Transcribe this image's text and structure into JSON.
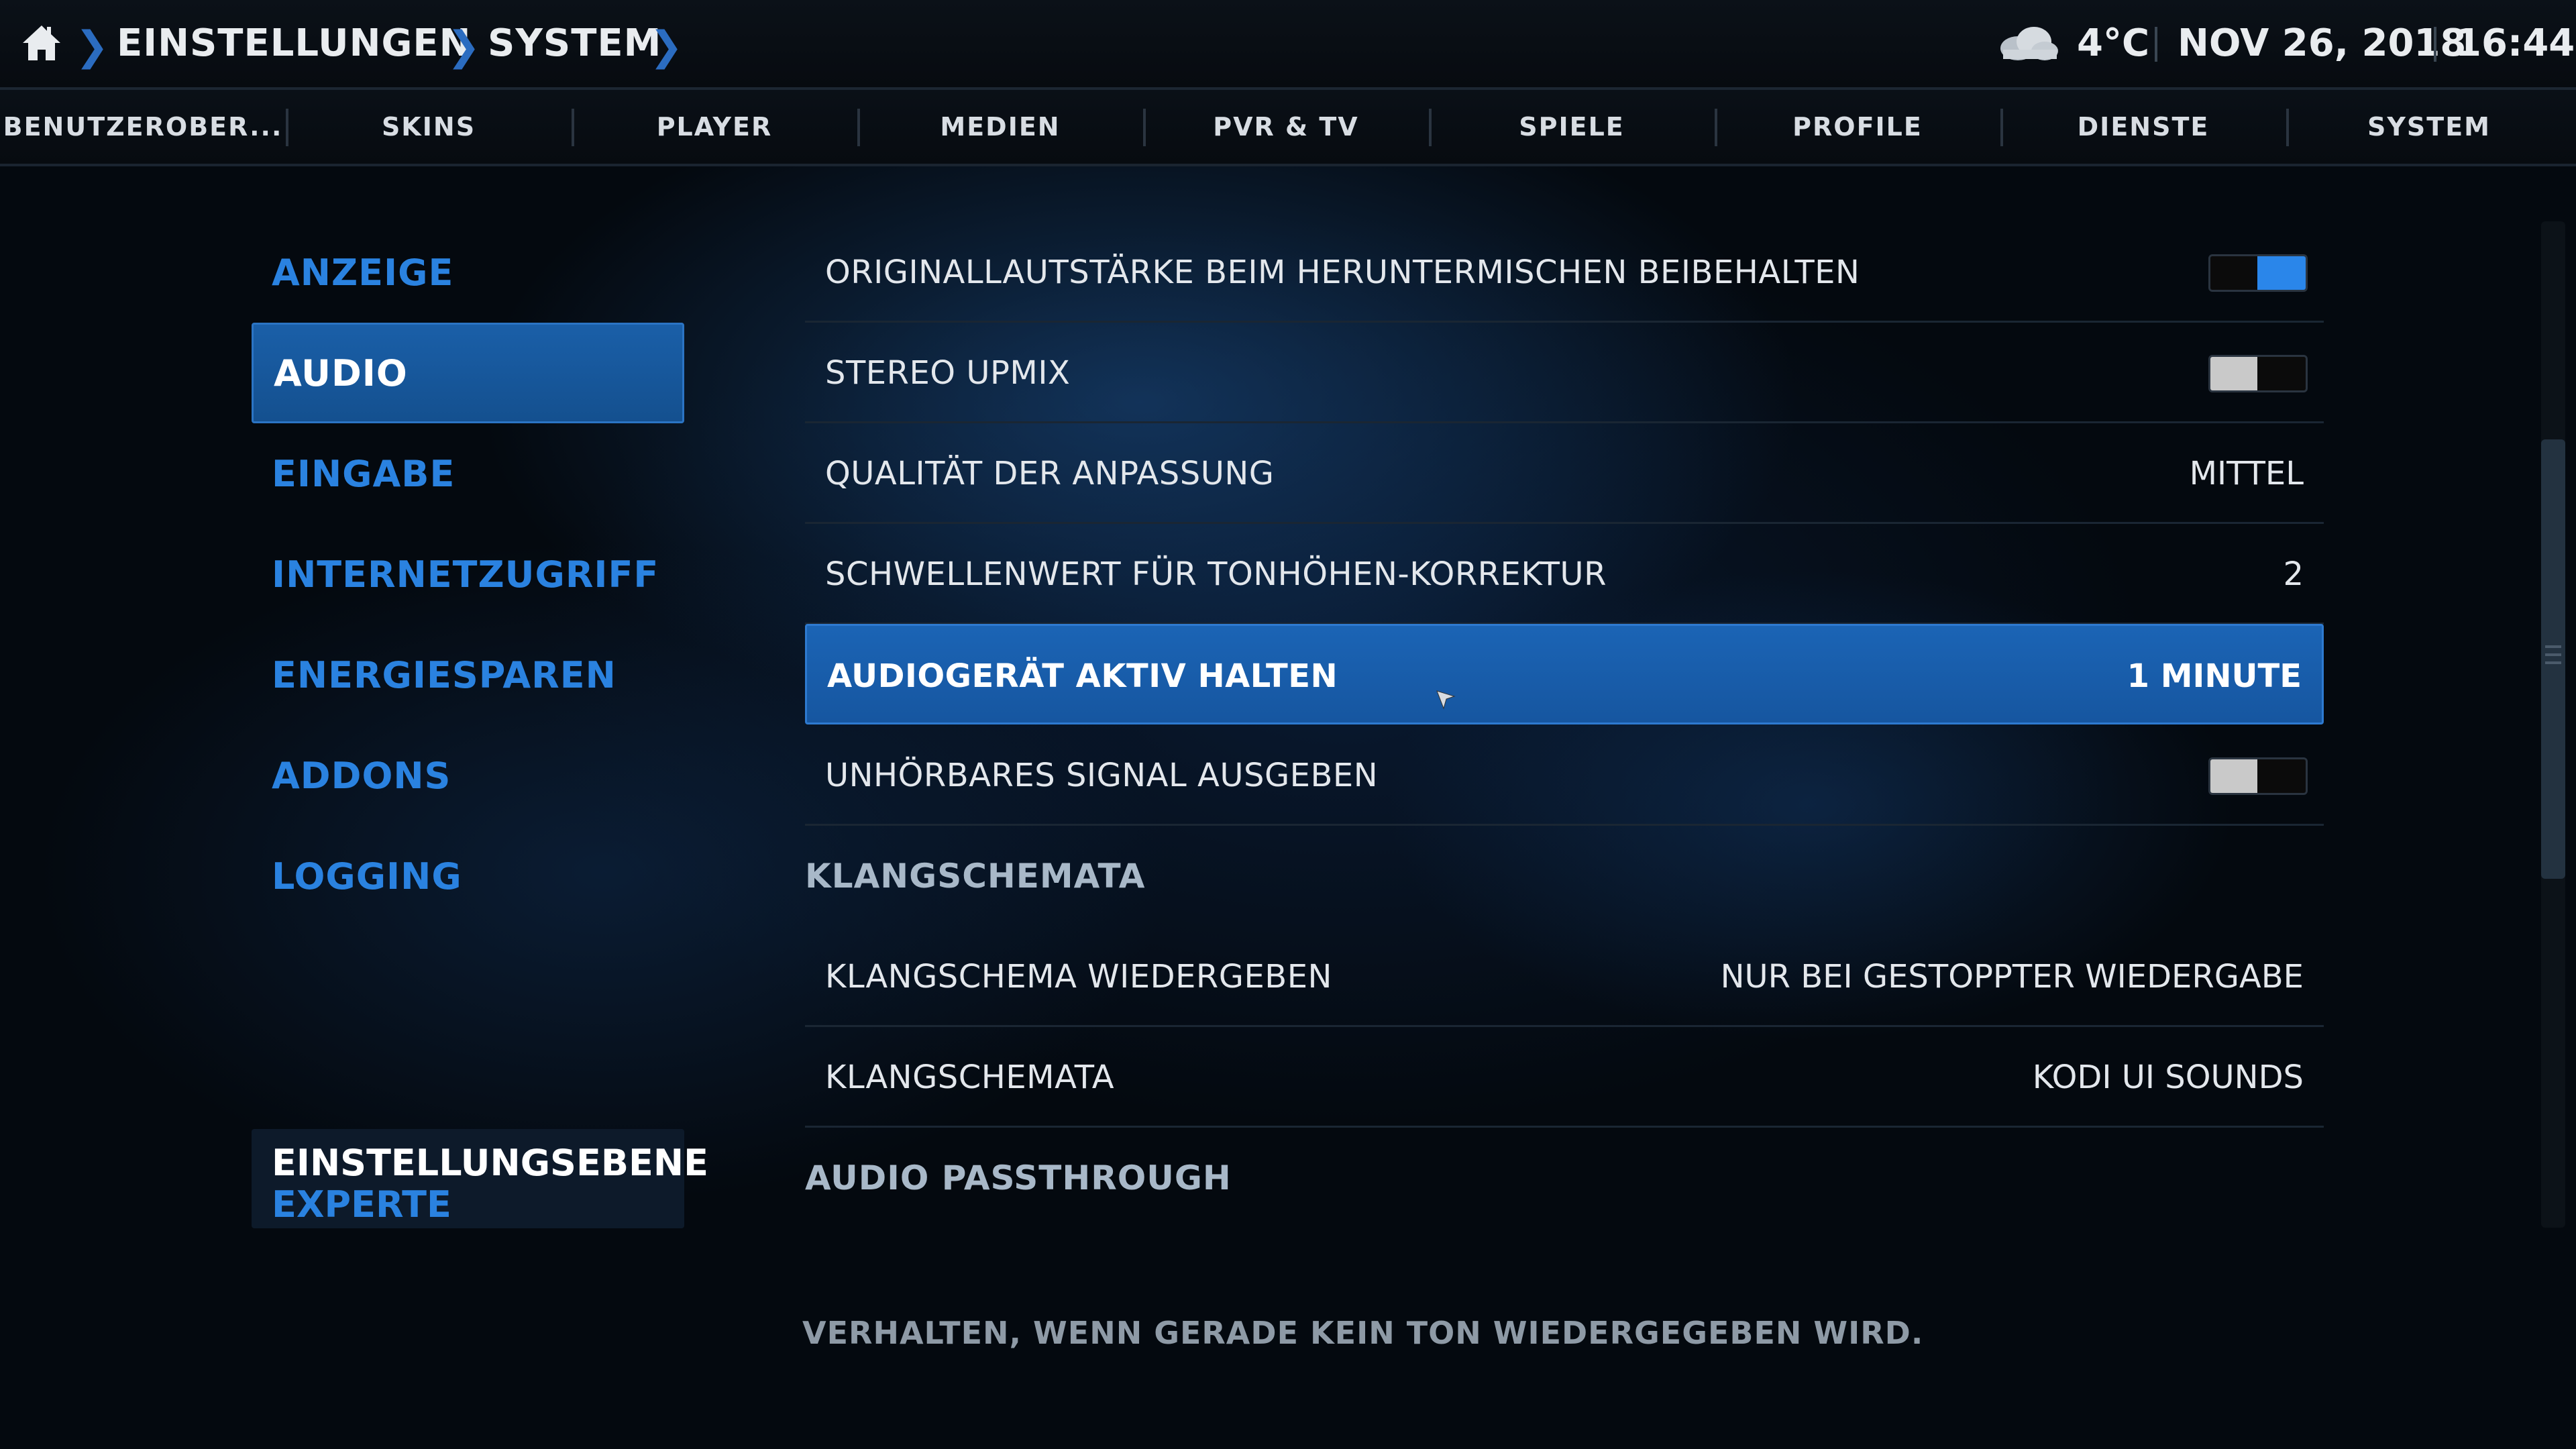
{
  "header": {
    "breadcrumb": [
      "EINSTELLUNGEN",
      "SYSTEM"
    ],
    "temperature": "4°C",
    "date": "NOV 26, 2018",
    "time": "16:44",
    "weather_icon": "cloud-icon"
  },
  "tabs": [
    "BENUTZEROBER...",
    "SKINS",
    "PLAYER",
    "MEDIEN",
    "PVR & TV",
    "SPIELE",
    "PROFILE",
    "DIENSTE",
    "SYSTEM"
  ],
  "menu": {
    "items": [
      "ANZEIGE",
      "AUDIO",
      "EINGABE",
      "INTERNETZUGRIFF",
      "ENERGIESPAREN",
      "ADDONS",
      "LOGGING"
    ],
    "active": "AUDIO",
    "level_title": "EINSTELLUNGSEBENE",
    "level_value": "EXPERTE"
  },
  "settings": {
    "row1": {
      "label": "ORIGINALLAUTSTÄRKE BEIM HERUNTERMISCHEN BEIBEHALTEN",
      "toggle": "on"
    },
    "row2": {
      "label": "STEREO UPMIX",
      "toggle": "off"
    },
    "row3": {
      "label": "QUALITÄT DER ANPASSUNG",
      "value": "MITTEL"
    },
    "row4": {
      "label": "SCHWELLENWERT FÜR TONHÖHEN-KORREKTUR",
      "value": "2"
    },
    "row5": {
      "label": "AUDIOGERÄT AKTIV HALTEN",
      "value": "1 MINUTE"
    },
    "row6": {
      "label": "UNHÖRBARES SIGNAL AUSGEBEN",
      "toggle": "off"
    },
    "section1": "KLANGSCHEMATA",
    "row7": {
      "label": "KLANGSCHEMA WIEDERGEBEN",
      "value": "NUR BEI GESTOPPTER WIEDERGABE"
    },
    "row8": {
      "label": "KLANGSCHEMATA",
      "value": "KODI UI SOUNDS"
    },
    "section2": "AUDIO PASSTHROUGH"
  },
  "description": "VERHALTEN, WENN GERADE KEIN TON WIEDERGEGEBEN WIRD.",
  "colors": {
    "accent": "#2a82e0",
    "focus": "#1b64b5",
    "background": "#04090f"
  }
}
